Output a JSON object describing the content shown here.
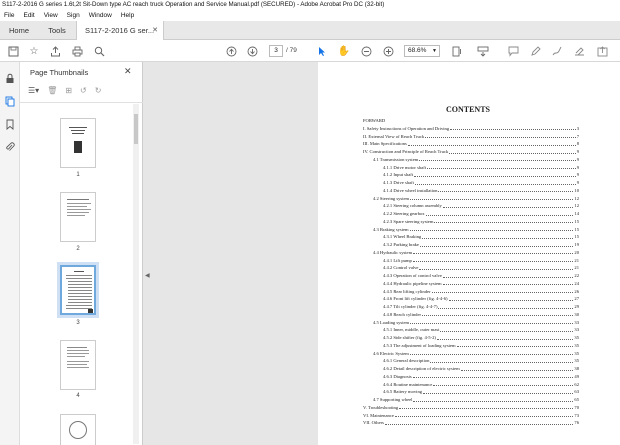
{
  "window": {
    "title": "S117-2-2016 G series 1.6t,2t Sit-Down type AC reach truck Operation and Service Manual.pdf (SECURED) - Adobe Acrobat Pro DC (32-bit)"
  },
  "menu": [
    "File",
    "Edit",
    "View",
    "Sign",
    "Window",
    "Help"
  ],
  "tabs": {
    "home": "Home",
    "tools": "Tools",
    "doc": "S117-2-2016 G ser..."
  },
  "toolbar": {
    "page_current": "3",
    "page_total": "/ 79",
    "zoom": "68.6%"
  },
  "panel": {
    "title": "Page Thumbnails",
    "thumbs": [
      "1",
      "2",
      "3",
      "4"
    ]
  },
  "accent": "#1473e6",
  "contents": {
    "heading": "CONTENTS",
    "rows": [
      {
        "label": "FORWARD",
        "page": "",
        "indent": 0
      },
      {
        "label": "I. Safety Instructions of Operation and Driving",
        "page": "3",
        "indent": 0
      },
      {
        "label": "II. External View of Reach Truck",
        "page": "7",
        "indent": 0
      },
      {
        "label": "III. Main Specifications",
        "page": "8",
        "indent": 0
      },
      {
        "label": "IV. Construction and Principle of Reach Truck",
        "page": "9",
        "indent": 0
      },
      {
        "label": "4.1 Transmission system",
        "page": "9",
        "indent": 1
      },
      {
        "label": "4.1.1 Drive motor shaft",
        "page": "9",
        "indent": 2
      },
      {
        "label": "4.1.2 Input shaft",
        "page": "9",
        "indent": 2
      },
      {
        "label": "4.1.3 Drive shaft",
        "page": "9",
        "indent": 2
      },
      {
        "label": "4.1.4 Drive wheel installation",
        "page": "10",
        "indent": 2
      },
      {
        "label": "4.2 Steering system",
        "page": "12",
        "indent": 1
      },
      {
        "label": "4.2.1 Steering column assembly",
        "page": "12",
        "indent": 2
      },
      {
        "label": "4.2.2 Steering gearbox",
        "page": "14",
        "indent": 2
      },
      {
        "label": "4.2.3 Spare steering system",
        "page": "15",
        "indent": 2
      },
      {
        "label": "4.3 Braking system",
        "page": "15",
        "indent": 1
      },
      {
        "label": "4.3.1 Wheel Braking",
        "page": "15",
        "indent": 2
      },
      {
        "label": "4.3.2 Parking brake",
        "page": "19",
        "indent": 2
      },
      {
        "label": "4.4 Hydraulic system",
        "page": "20",
        "indent": 1
      },
      {
        "label": "4.4.1 Lift pump",
        "page": "21",
        "indent": 2
      },
      {
        "label": "4.4.2 Control valve",
        "page": "21",
        "indent": 2
      },
      {
        "label": "4.4.3 Operation of control valve",
        "page": "22",
        "indent": 2
      },
      {
        "label": "4.4.4 Hydraulic pipeline system",
        "page": "24",
        "indent": 2
      },
      {
        "label": "4.4.5 Rear lifting cylinder",
        "page": "26",
        "indent": 2
      },
      {
        "label": "4.4.6 Front lift cylinder (fig. 4-4-6)",
        "page": "27",
        "indent": 2
      },
      {
        "label": "4.4.7 Tilt cylinder (fig. 4-4-7)",
        "page": "29",
        "indent": 2
      },
      {
        "label": "4.4.8 Reach cylinder",
        "page": "30",
        "indent": 2
      },
      {
        "label": "4.5 Loading system",
        "page": "33",
        "indent": 1
      },
      {
        "label": "4.5.1 Inner, middle, outer mast",
        "page": "33",
        "indent": 2
      },
      {
        "label": "4.5.2 Side shifter (fig. 4-5-2)",
        "page": "35",
        "indent": 2
      },
      {
        "label": "4.5.3 The adjustment of loading system",
        "page": "35",
        "indent": 2
      },
      {
        "label": "4.6 Electric System",
        "page": "35",
        "indent": 1
      },
      {
        "label": "4.6.1 General description",
        "page": "35",
        "indent": 2
      },
      {
        "label": "4.6.2 Detail description of electric system",
        "page": "38",
        "indent": 2
      },
      {
        "label": "4.6.3 Diagnosis",
        "page": "49",
        "indent": 2
      },
      {
        "label": "4.6.4 Routine maintenance",
        "page": "62",
        "indent": 2
      },
      {
        "label": "4.6.5 Battery moving",
        "page": "63",
        "indent": 2
      },
      {
        "label": "4.7 Supporting wheel",
        "page": "65",
        "indent": 1
      },
      {
        "label": "V. Troubleshooting",
        "page": "70",
        "indent": 0
      },
      {
        "label": "VI. Maintenance",
        "page": "73",
        "indent": 0
      },
      {
        "label": "VII. Others",
        "page": "76",
        "indent": 0
      }
    ]
  }
}
